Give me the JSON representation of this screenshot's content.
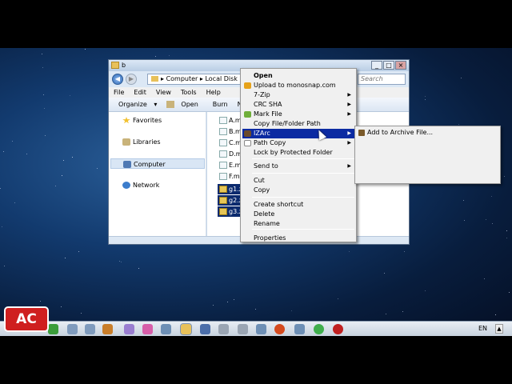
{
  "window": {
    "title": "b",
    "address": {
      "segments": [
        "Computer",
        "Local Disk"
      ],
      "separator": "▸"
    },
    "search_placeholder": "Search",
    "menu": [
      "File",
      "Edit",
      "View",
      "Tools",
      "Help"
    ],
    "commands": {
      "organize": "Organize",
      "open": "Open",
      "burn": "Burn",
      "new_folder": "Ne"
    },
    "nav": [
      {
        "label": "Favorites",
        "icon": "star-icon",
        "color": "#f2c130"
      },
      {
        "label": "Libraries",
        "icon": "libraries-icon",
        "color": "#c9b37a"
      },
      {
        "label": "Computer",
        "icon": "computer-icon",
        "color": "#4f79b3",
        "selected": true
      },
      {
        "label": "Network",
        "icon": "network-icon",
        "color": "#3c7dcc"
      }
    ],
    "files": [
      {
        "name": "A.m",
        "selected": false
      },
      {
        "name": "B.m",
        "selected": false
      },
      {
        "name": "C.m",
        "selected": false
      },
      {
        "name": "D.m",
        "selected": false
      },
      {
        "name": "E.m",
        "selected": false
      },
      {
        "name": "F.m",
        "selected": false
      },
      {
        "name": "g1.zip",
        "selected": true
      },
      {
        "name": "g2.zip",
        "selected": true
      },
      {
        "name": "g3.zip",
        "selected": true
      }
    ]
  },
  "context_menu": {
    "items": [
      {
        "label": "Open",
        "bold": true
      },
      {
        "label": "Upload to monosnap.com",
        "icon_color": "#e6a21a"
      },
      {
        "label": "7-Zip",
        "submenu": true
      },
      {
        "label": "CRC SHA",
        "submenu": true
      },
      {
        "label": "Mark File",
        "submenu": true,
        "icon_color": "#6fae3a"
      },
      {
        "label": "Copy File/Folder Path"
      },
      {
        "label": "IZArc",
        "submenu": true,
        "highlighted": true,
        "icon_color": "#6b4a2a"
      },
      {
        "label": "Path Copy",
        "submenu": true,
        "icon_color": "#ffffff"
      },
      {
        "label": "Lock by Protected Folder"
      },
      {
        "label": "Send to",
        "submenu": true
      },
      {
        "label": "Cut"
      },
      {
        "label": "Copy"
      },
      {
        "label": "Create shortcut"
      },
      {
        "label": "Delete"
      },
      {
        "label": "Rename"
      },
      {
        "label": "Properties"
      }
    ],
    "submenu_item": "Add to Archive File..."
  },
  "taskbar": {
    "language": "EN",
    "icon_colors": [
      "#3b9d3b",
      "#7f9bbd",
      "#7f9bbd",
      "#c97e2a",
      "#9a7ed0",
      "#d75ea9",
      "#6d8fb5",
      "#e8c15a",
      "#4b6ea9",
      "#9aa5b3",
      "#9aa5b3",
      "#6d8fb5",
      "#d44a1e",
      "#6d8fb5",
      "#3fae4c",
      "#c02020"
    ]
  },
  "logo_text": "AC"
}
